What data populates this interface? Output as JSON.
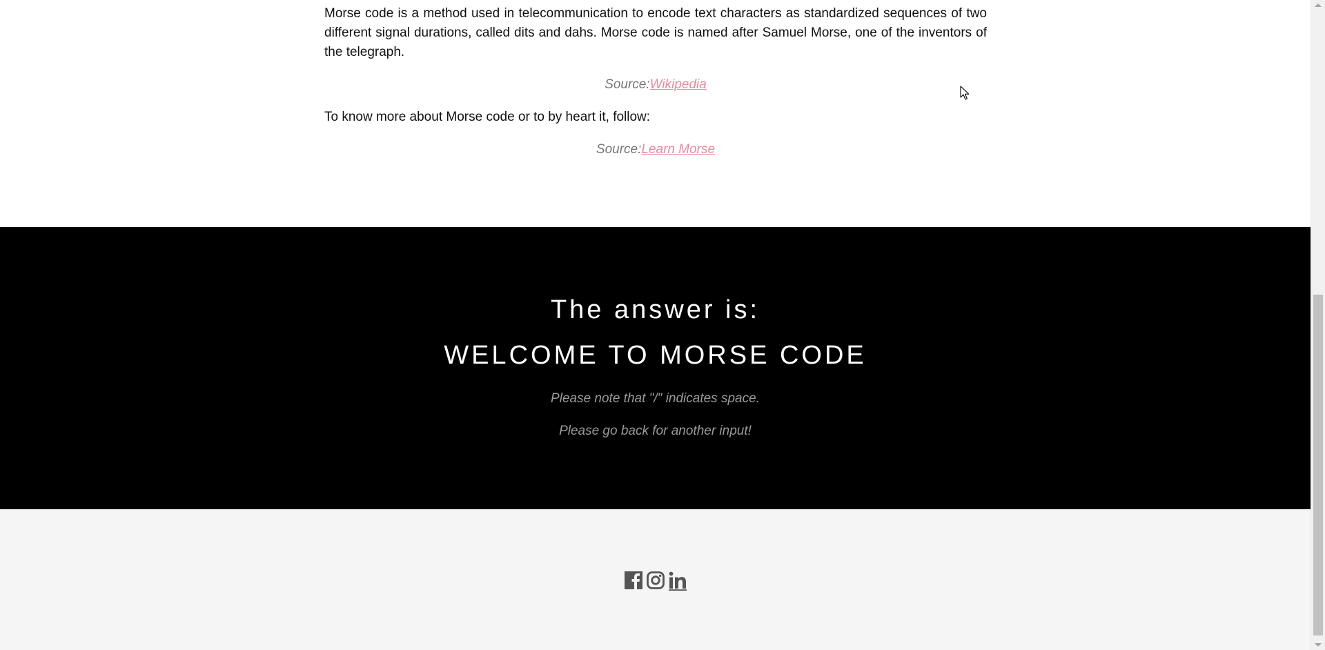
{
  "info": {
    "paragraph1": "Morse code is a method used in telecommunication to encode text characters as standardized sequences of two different signal durations, called dits and dahs. Morse code is named after Samuel Morse, one of the inventors of the telegraph.",
    "source1_prefix": "Source:",
    "source1_link": "Wikipedia",
    "paragraph2": "To know more about Morse code or to by heart it, follow:",
    "source2_prefix": "Source:",
    "source2_link": "Learn Morse"
  },
  "answer": {
    "heading": "The answer is:",
    "result": "WELCOME TO MORSE CODE",
    "note1": "Please note that \"/\" indicates space.",
    "note2": "Please go back for another input!"
  },
  "footer": {
    "social": [
      {
        "icon": "facebook-icon"
      },
      {
        "icon": "instagram-icon"
      },
      {
        "icon": "linkedin-icon"
      }
    ]
  },
  "colors": {
    "link": "#e78a9f",
    "answer_bg": "#000000",
    "footer_bg": "#f5f5f5",
    "icon": "#555555"
  }
}
